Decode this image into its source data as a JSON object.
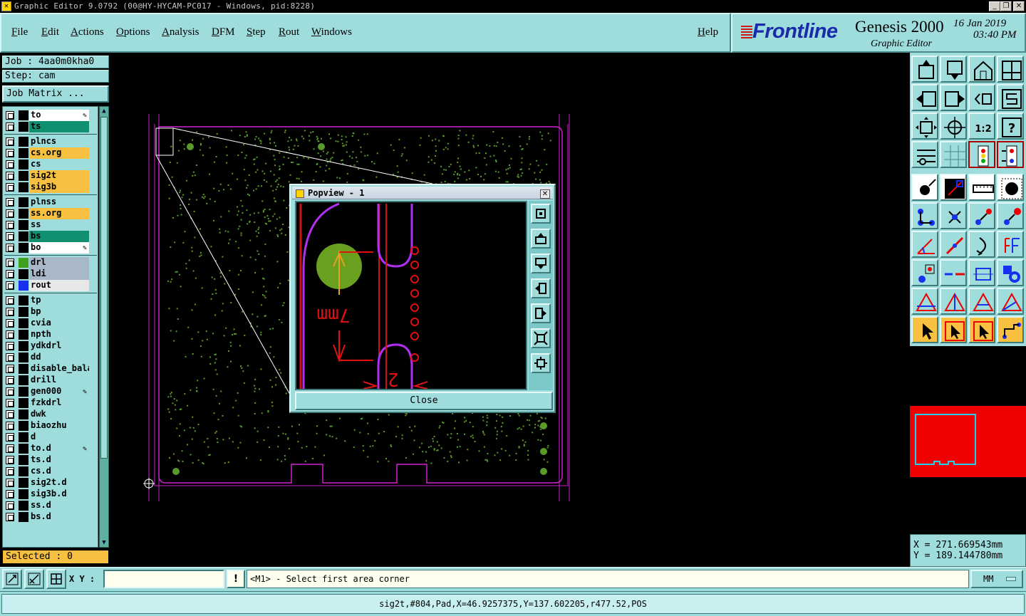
{
  "window": {
    "title": "Graphic Editor 9.0792 (00@HY-HYCAM-PC017 - Windows, pid:8228)",
    "controls": [
      "_",
      "❐",
      "✕"
    ]
  },
  "menu": [
    "File",
    "Edit",
    "Actions",
    "Options",
    "Analysis",
    "DFM",
    "Step",
    "Rout",
    "Windows"
  ],
  "help_label": "Help",
  "brand": {
    "logo": "Frontline",
    "product": "Genesis 2000",
    "subtitle": "Graphic Editor",
    "date": "16 Jan 2019",
    "time": "03:40 PM"
  },
  "job": {
    "label": "Job : 4aa0m0kha0",
    "step": "Step: cam",
    "matrix_button": "Job Matrix ..."
  },
  "layers": [
    {
      "name": "to",
      "color": "#ffffff",
      "swatch": "#000000",
      "edit": true
    },
    {
      "name": "ts",
      "color": "#109070",
      "swatch": "#000000",
      "edit": false
    },
    {
      "name": "plncs",
      "color": "#9fdcdc",
      "swatch": "#000000",
      "edit": false
    },
    {
      "name": "cs.org",
      "color": "#f8c040",
      "swatch": "#000000",
      "edit": false
    },
    {
      "name": "cs",
      "color": "#9fdcdc",
      "swatch": "#000000",
      "edit": false
    },
    {
      "name": "sig2t",
      "color": "#f8c040",
      "swatch": "#000000",
      "edit": false
    },
    {
      "name": "sig3b",
      "color": "#f8c040",
      "swatch": "#000000",
      "edit": false
    },
    {
      "name": "plnss",
      "color": "#9fdcdc",
      "swatch": "#000000",
      "edit": false
    },
    {
      "name": "ss.org",
      "color": "#f8c040",
      "swatch": "#000000",
      "edit": false
    },
    {
      "name": "ss",
      "color": "#9fdcdc",
      "swatch": "#000000",
      "edit": false
    },
    {
      "name": "bs",
      "color": "#109070",
      "swatch": "#000000",
      "edit": false
    },
    {
      "name": "bo",
      "color": "#ffffff",
      "swatch": "#000000",
      "edit": true
    },
    {
      "name": "drl",
      "color": "#a8b8c8",
      "swatch": "#40a020",
      "edit": false
    },
    {
      "name": "ldi",
      "color": "#a8b8c8",
      "swatch": "#000000",
      "edit": false
    },
    {
      "name": "rout",
      "color": "#e8e8e8",
      "swatch": "#1830f0",
      "edit": false
    },
    {
      "name": "tp",
      "color": "#9fdcdc",
      "swatch": "#000000",
      "edit": false
    },
    {
      "name": "bp",
      "color": "#9fdcdc",
      "swatch": "#000000",
      "edit": false
    },
    {
      "name": "cvia",
      "color": "#9fdcdc",
      "swatch": "#000000",
      "edit": false
    },
    {
      "name": "npth",
      "color": "#9fdcdc",
      "swatch": "#000000",
      "edit": false
    },
    {
      "name": "ydkdrl",
      "color": "#9fdcdc",
      "swatch": "#000000",
      "edit": false
    },
    {
      "name": "dd",
      "color": "#9fdcdc",
      "swatch": "#000000",
      "edit": false
    },
    {
      "name": "disable_bala",
      "color": "#9fdcdc",
      "swatch": "#000000",
      "edit": false
    },
    {
      "name": "drill",
      "color": "#9fdcdc",
      "swatch": "#000000",
      "edit": false
    },
    {
      "name": "gen000",
      "color": "#9fdcdc",
      "swatch": "#000000",
      "edit": true
    },
    {
      "name": "fzkdrl",
      "color": "#9fdcdc",
      "swatch": "#000000",
      "edit": false
    },
    {
      "name": "dwk",
      "color": "#9fdcdc",
      "swatch": "#000000",
      "edit": false
    },
    {
      "name": "biaozhu",
      "color": "#9fdcdc",
      "swatch": "#000000",
      "edit": false
    },
    {
      "name": "d",
      "color": "#9fdcdc",
      "swatch": "#000000",
      "edit": false
    },
    {
      "name": "to.d",
      "color": "#9fdcdc",
      "swatch": "#000000",
      "edit": true
    },
    {
      "name": "ts.d",
      "color": "#9fdcdc",
      "swatch": "#000000",
      "edit": false
    },
    {
      "name": "cs.d",
      "color": "#9fdcdc",
      "swatch": "#000000",
      "edit": false
    },
    {
      "name": "sig2t.d",
      "color": "#9fdcdc",
      "swatch": "#000000",
      "edit": false
    },
    {
      "name": "sig3b.d",
      "color": "#9fdcdc",
      "swatch": "#000000",
      "edit": false
    },
    {
      "name": "ss.d",
      "color": "#9fdcdc",
      "swatch": "#000000",
      "edit": false
    },
    {
      "name": "bs.d",
      "color": "#9fdcdc",
      "swatch": "#000000",
      "edit": false
    }
  ],
  "selected": "Selected : 0",
  "popview": {
    "title": "Popview - 1",
    "close_label": "Close",
    "dimension_label": "7mm",
    "trace_label": "2"
  },
  "coords": {
    "x": "X  =  271.669543mm",
    "y": "Y  =  189.144780mm"
  },
  "cmd": {
    "xy_label": "X Y :",
    "xy_value": "",
    "message": "<M1> - Select first area corner",
    "units": "MM"
  },
  "status": "sig2t,#804,Pad,X=46.9257375,Y=137.602205,r477.52,POS",
  "colors": {
    "panel": "#9fdcdc",
    "board_outline": "#d020d0",
    "pads": "#5a9a2a",
    "accent": "#f8c040"
  }
}
